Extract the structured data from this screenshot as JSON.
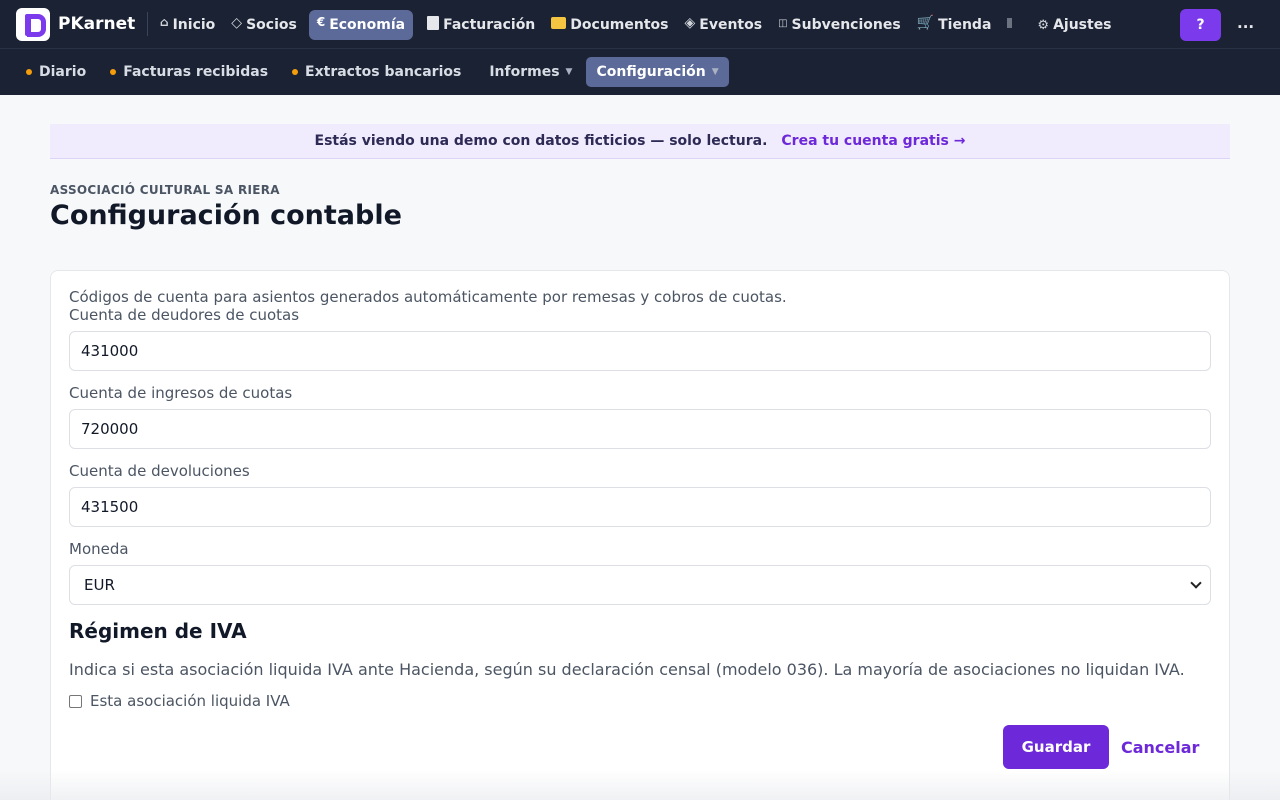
{
  "app": {
    "brand": "PKarnet"
  },
  "nav": {
    "items": [
      {
        "label": "Inicio",
        "icon": "home-icon"
      },
      {
        "label": "Socios",
        "icon": "diamond-icon"
      },
      {
        "label": "Economía",
        "icon": "euro-icon",
        "active": true
      },
      {
        "label": "Facturación",
        "icon": "document-icon"
      },
      {
        "label": "Documentos",
        "icon": "folder-icon"
      },
      {
        "label": "Eventos",
        "icon": "event-icon"
      },
      {
        "label": "Subvenciones",
        "icon": "grant-icon"
      },
      {
        "label": "Tienda",
        "icon": "cart-icon"
      },
      {
        "label": "",
        "icon": "half-square-icon"
      },
      {
        "label": "Ajustes",
        "icon": "gear-icon"
      }
    ],
    "help_label": "?",
    "more_label": "..."
  },
  "subnav": {
    "items": [
      {
        "label": "Diario",
        "dot": true
      },
      {
        "label": "Facturas recibidas",
        "dot": true
      },
      {
        "label": "Extractos bancarios",
        "dot": true
      },
      {
        "label": "Informes",
        "caret": true
      },
      {
        "label": "Configuración",
        "caret": true,
        "active": true
      }
    ]
  },
  "banner": {
    "text": "Estás viendo una demo con datos ficticios — solo lectura.",
    "link": "Crea tu cuenta gratis →"
  },
  "page": {
    "org": "Associació Cultural Sa Riera",
    "title": "Configuración contable"
  },
  "form": {
    "intro": "Códigos de cuenta para asientos generados automáticamente por remesas y cobros de cuotas.",
    "debtors_label": "Cuenta de deudores de cuotas",
    "debtors_value": "431000",
    "income_label": "Cuenta de ingresos de cuotas",
    "income_value": "720000",
    "returns_label": "Cuenta de devoluciones",
    "returns_value": "431500",
    "currency_label": "Moneda",
    "currency_value": "EUR",
    "vat_heading": "Régimen de IVA",
    "vat_desc": "Indica si esta asociación liquida IVA ante Hacienda, según su declaración censal (modelo 036). La mayoría de asociaciones no liquidan IVA.",
    "vat_checkbox_label": "Esta asociación liquida IVA",
    "vat_checked": false,
    "save_label": "Guardar",
    "cancel_label": "Cancelar"
  },
  "colors": {
    "nav_bg": "#1a2233",
    "accent": "#6d28d9",
    "active_tab": "#5b6a99"
  }
}
